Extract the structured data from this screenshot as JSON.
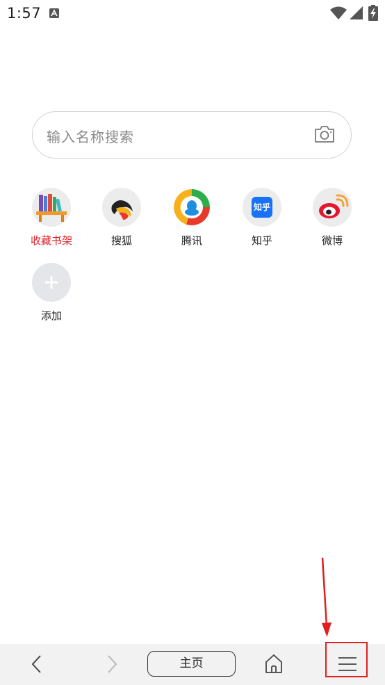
{
  "status_bar": {
    "time": "1:57",
    "notification_icon": "a-notification-icon",
    "wifi_icon": "wifi-icon",
    "signal_icon": "signal-icon",
    "battery_icon": "battery-charging-icon"
  },
  "search": {
    "placeholder": "输入名称搜索",
    "camera_icon": "camera-icon"
  },
  "shortcuts": [
    {
      "label": "收藏书架",
      "icon": "bookshelf-icon",
      "label_color": "#e3252b"
    },
    {
      "label": "搜狐",
      "icon": "sohu-icon"
    },
    {
      "label": "腾讯",
      "icon": "tencent-icon"
    },
    {
      "label": "知乎",
      "icon": "zhihu-icon",
      "icon_text": "知乎"
    },
    {
      "label": "微博",
      "icon": "weibo-icon"
    },
    {
      "label": "添加",
      "icon": "plus-icon"
    }
  ],
  "bottom_nav": {
    "back_icon": "chevron-left-icon",
    "forward_icon": "chevron-right-icon",
    "home_label": "主页",
    "home_icon": "house-icon",
    "menu_icon": "hamburger-menu-icon"
  },
  "annotation": {
    "highlight_color": "#e02020"
  }
}
